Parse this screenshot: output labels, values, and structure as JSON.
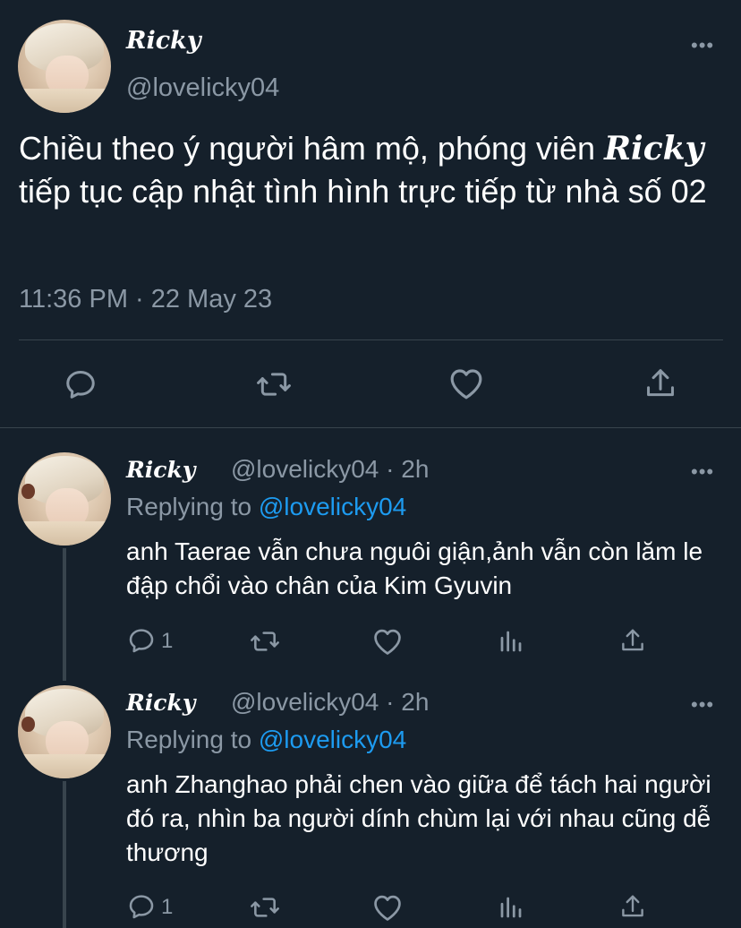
{
  "main_tweet": {
    "display_name": "Ricky",
    "handle": "@lovelicky04",
    "text_part1": "Chiều theo ý người hâm mộ, phóng viên ",
    "text_name": "Ricky",
    "text_part2": " tiếp tục cập nhật tình hình trực tiếp từ nhà số 02",
    "timestamp": "11:36 PM · 22 May 23",
    "actions": [
      "reply-icon",
      "retweet-icon",
      "like-icon",
      "share-icon"
    ]
  },
  "replies": [
    {
      "display_name": "Ricky",
      "handle_time": "@lovelicky04 · 2h",
      "replying_prefix": "Replying to ",
      "replying_mention": "@lovelicky04",
      "text": "anh Taerae vẫn chưa nguôi giận,ảnh vẫn còn lăm le đập chổi vào chân của Kim Gyuvin",
      "reply_count": "1"
    },
    {
      "display_name": "Ricky",
      "handle_time": "@lovelicky04 · 2h",
      "replying_prefix": "Replying to ",
      "replying_mention": "@lovelicky04",
      "text": "anh Zhanghao phải chen vào giữa để tách hai người đó ra, nhìn ba người dính chùm lại với nhau cũng dễ thương",
      "reply_count": "1"
    }
  ],
  "colors": {
    "background": "#15202b",
    "text_primary": "#ffffff",
    "text_secondary": "#8b98a5",
    "link": "#1d9bf0",
    "divider": "#38444d"
  },
  "more_icon": "more-icon"
}
